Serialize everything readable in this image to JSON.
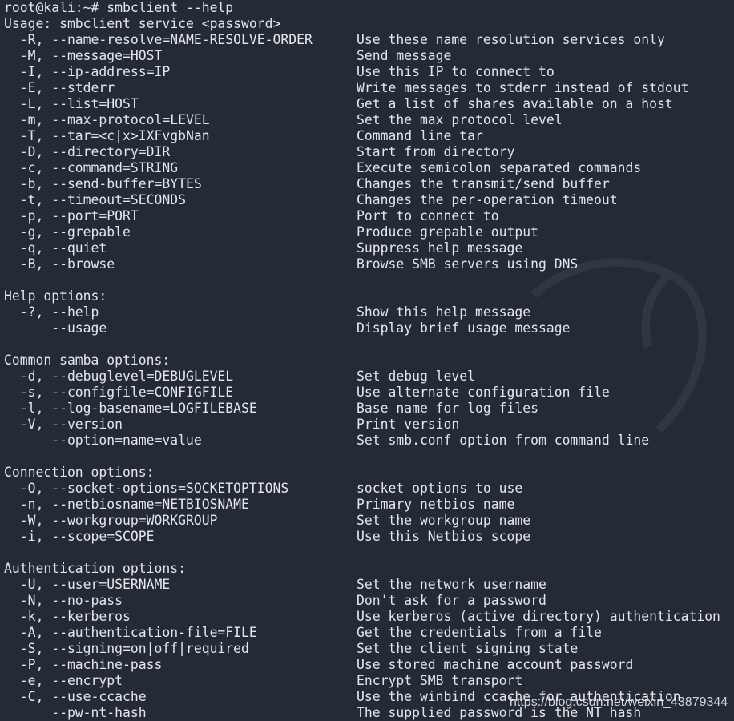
{
  "terminal": {
    "prompt": "root@kali:~# smbclient --help",
    "lines": [
      [
        "Usage: smbclient service <password>",
        ""
      ],
      [
        "  -R, --name-resolve=NAME-RESOLVE-ORDER",
        "Use these name resolution services only"
      ],
      [
        "  -M, --message=HOST",
        "Send message"
      ],
      [
        "  -I, --ip-address=IP",
        "Use this IP to connect to"
      ],
      [
        "  -E, --stderr",
        "Write messages to stderr instead of stdout"
      ],
      [
        "  -L, --list=HOST",
        "Get a list of shares available on a host"
      ],
      [
        "  -m, --max-protocol=LEVEL",
        "Set the max protocol level"
      ],
      [
        "  -T, --tar=<c|x>IXFvgbNan",
        "Command line tar"
      ],
      [
        "  -D, --directory=DIR",
        "Start from directory"
      ],
      [
        "  -c, --command=STRING",
        "Execute semicolon separated commands"
      ],
      [
        "  -b, --send-buffer=BYTES",
        "Changes the transmit/send buffer"
      ],
      [
        "  -t, --timeout=SECONDS",
        "Changes the per-operation timeout"
      ],
      [
        "  -p, --port=PORT",
        "Port to connect to"
      ],
      [
        "  -g, --grepable",
        "Produce grepable output"
      ],
      [
        "  -q, --quiet",
        "Suppress help message"
      ],
      [
        "  -B, --browse",
        "Browse SMB servers using DNS"
      ],
      [
        "",
        ""
      ],
      [
        "Help options:",
        ""
      ],
      [
        "  -?, --help",
        "Show this help message"
      ],
      [
        "      --usage",
        "Display brief usage message"
      ],
      [
        "",
        ""
      ],
      [
        "Common samba options:",
        ""
      ],
      [
        "  -d, --debuglevel=DEBUGLEVEL",
        "Set debug level"
      ],
      [
        "  -s, --configfile=CONFIGFILE",
        "Use alternate configuration file"
      ],
      [
        "  -l, --log-basename=LOGFILEBASE",
        "Base name for log files"
      ],
      [
        "  -V, --version",
        "Print version"
      ],
      [
        "      --option=name=value",
        "Set smb.conf option from command line"
      ],
      [
        "",
        ""
      ],
      [
        "Connection options:",
        ""
      ],
      [
        "  -O, --socket-options=SOCKETOPTIONS",
        "socket options to use"
      ],
      [
        "  -n, --netbiosname=NETBIOSNAME",
        "Primary netbios name"
      ],
      [
        "  -W, --workgroup=WORKGROUP",
        "Set the workgroup name"
      ],
      [
        "  -i, --scope=SCOPE",
        "Use this Netbios scope"
      ],
      [
        "",
        ""
      ],
      [
        "Authentication options:",
        ""
      ],
      [
        "  -U, --user=USERNAME",
        "Set the network username"
      ],
      [
        "  -N, --no-pass",
        "Don't ask for a password"
      ],
      [
        "  -k, --kerberos",
        "Use kerberos (active directory) authentication"
      ],
      [
        "  -A, --authentication-file=FILE",
        "Get the credentials from a file"
      ],
      [
        "  -S, --signing=on|off|required",
        "Set the client signing state"
      ],
      [
        "  -P, --machine-pass",
        "Use stored machine account password"
      ],
      [
        "  -e, --encrypt",
        "Encrypt SMB transport"
      ],
      [
        "  -C, --use-ccache",
        "Use the winbind ccache for authentication"
      ],
      [
        "      --pw-nt-hash",
        "The supplied password is the NT hash"
      ]
    ]
  },
  "watermark": "https://blog.csdn.net/weixin_43879344",
  "colors": {
    "background": "#242a36",
    "text": "#e4e6ea"
  }
}
